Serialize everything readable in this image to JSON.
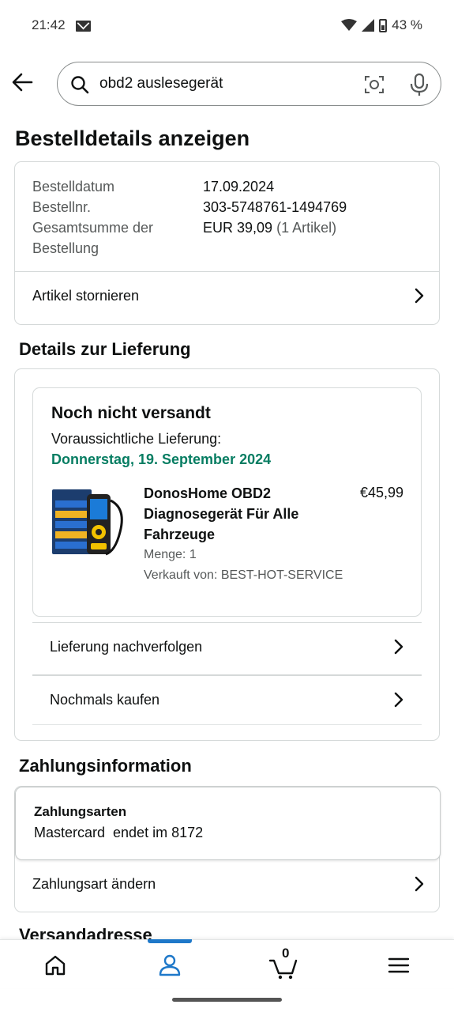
{
  "status_bar": {
    "time": "21:42",
    "battery": "43 %"
  },
  "search": {
    "query": "obd2 auslesegerät"
  },
  "page_title": "Bestelldetails anzeigen",
  "order_summary": {
    "date_label": "Bestelldatum",
    "date_value": "17.09.2024",
    "number_label": "Bestellnr.",
    "number_value": "303-5748761-1494769",
    "total_label": "Gesamtsumme der Bestellung",
    "total_value": "EUR 39,09",
    "total_count": "(1 Artikel)",
    "cancel_label": "Artikel stornieren"
  },
  "delivery": {
    "section_title": "Details zur Lieferung",
    "status": "Noch nicht versandt",
    "expected_label": "Voraussichtliche Lieferung:",
    "expected_date": "Donnerstag, 19. September 2024",
    "product": {
      "name": "DonosHome OBD2 Diagnosegerät Für Alle Fahrzeuge",
      "price": "€45,99",
      "quantity": "Menge: 1",
      "seller": "Verkauft von: BEST-HOT-SERVICE"
    },
    "track_label": "Lieferung nachverfolgen",
    "rebuy_label": "Nochmals kaufen"
  },
  "payment": {
    "section_title": "Zahlungsinformation",
    "methods_label": "Zahlungsarten",
    "method_value": "Mastercard  endet im 8172",
    "change_label": "Zahlungsart ändern"
  },
  "shipping_section_title": "Versandadresse",
  "bottom_nav": {
    "cart_count": "0",
    "active": "account"
  },
  "colors": {
    "accent": "#1e78c9",
    "delivery_date": "#067d62"
  }
}
